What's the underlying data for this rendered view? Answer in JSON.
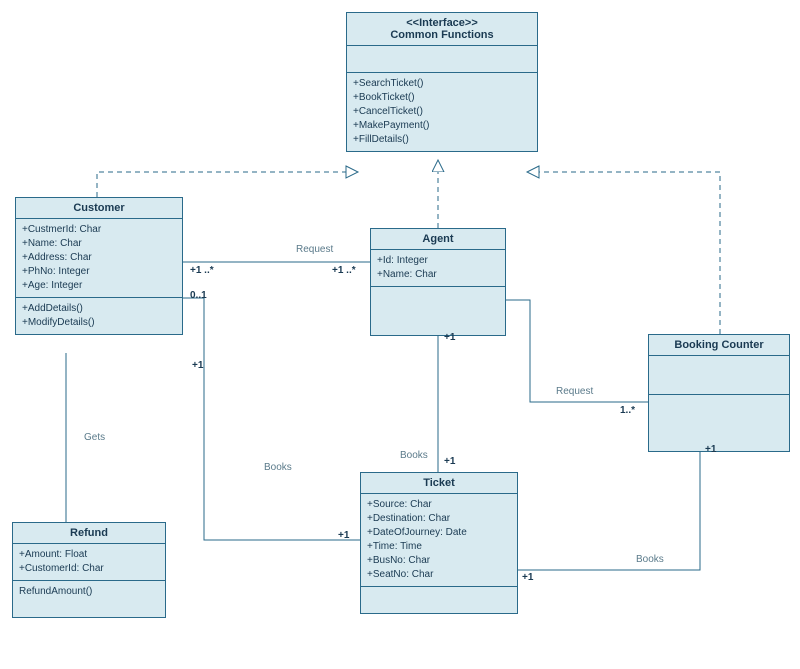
{
  "interface": {
    "stereotype": "<<Interface>>",
    "name": "Common Functions",
    "operations": [
      "+SearchTicket()",
      "+BookTicket()",
      "+CancelTicket()",
      "+MakePayment()",
      "+FillDetails()"
    ]
  },
  "customer": {
    "name": "Customer",
    "attributes": [
      "+CustmerId: Char",
      "+Name: Char",
      "+Address: Char",
      "+PhNo: Integer",
      "+Age: Integer"
    ],
    "operations": [
      "+AddDetails()",
      "+ModifyDetails()"
    ]
  },
  "agent": {
    "name": "Agent",
    "attributes": [
      "+Id: Integer",
      "+Name: Char"
    ]
  },
  "bookingCounter": {
    "name": "Booking Counter"
  },
  "ticket": {
    "name": "Ticket",
    "attributes": [
      "+Source: Char",
      "+Destination: Char",
      "+DateOfJourney: Date",
      "+Time: Time",
      "+BusNo: Char",
      "+SeatNo: Char"
    ]
  },
  "refund": {
    "name": "Refund",
    "attributes": [
      "+Amount: Float",
      "+CustomerId: Char"
    ],
    "operations": [
      "RefundAmount()"
    ]
  },
  "labels": {
    "request1": "Request",
    "request2": "Request",
    "gets": "Gets",
    "books1": "Books",
    "books2": "Books",
    "books3": "Books"
  },
  "mult": {
    "custAgentL": "+1 ..*",
    "custAgentR": "+1 ..*",
    "custTicketT": "0..1",
    "custTicketB": "+1",
    "custRefund": "+1",
    "agentTicketT": "+1",
    "agentTicketB": "+1",
    "agentBookingR": "1..*",
    "ticketBookingL": "+1",
    "ticketBookingR": "+1"
  }
}
